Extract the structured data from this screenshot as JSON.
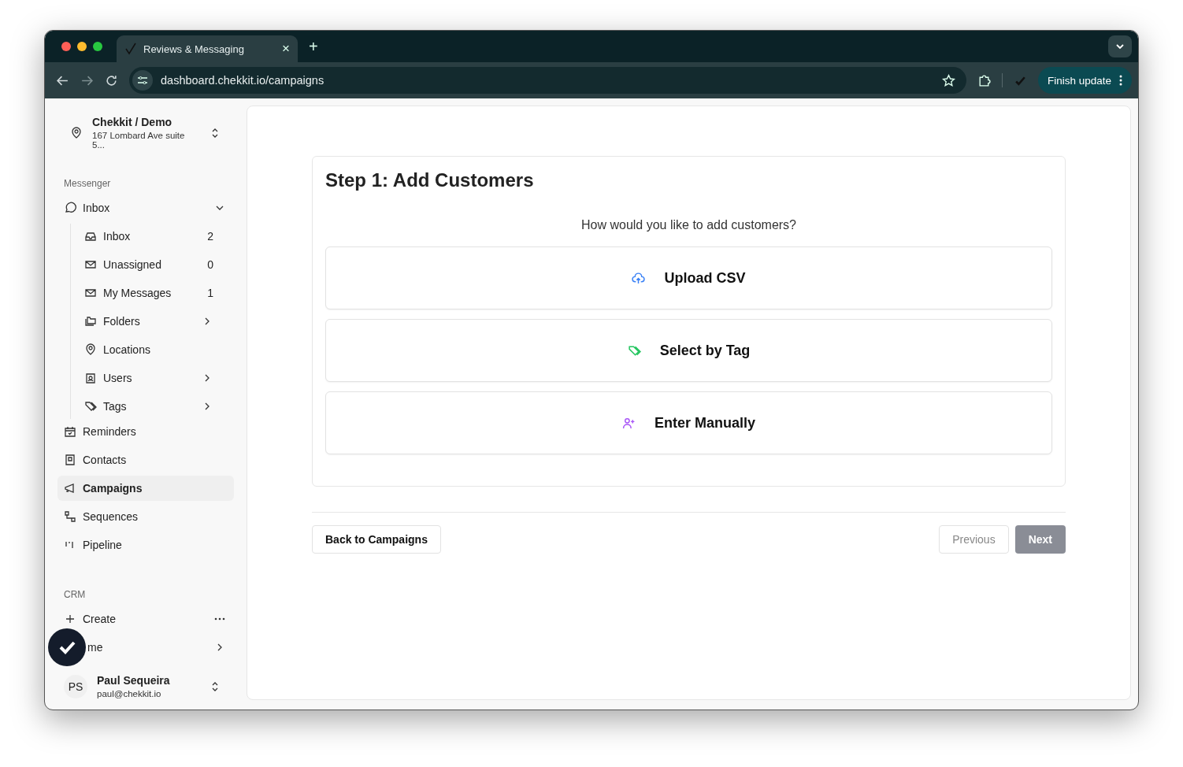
{
  "browser": {
    "tab": {
      "title": "Reviews & Messaging",
      "close": "×"
    },
    "new_tab": "+",
    "address": "dashboard.chekkit.io/campaigns",
    "update_button": "Finish update"
  },
  "sidebar": {
    "org": {
      "name": "Chekkit / Demo",
      "address": "167 Lombard Ave suite 5..."
    },
    "sections": [
      {
        "title": "Messenger",
        "items": [
          {
            "label": "Inbox",
            "expanded": true,
            "selected": false,
            "children": [
              {
                "label": "Inbox",
                "count": "2",
                "expandable": false
              },
              {
                "label": "Unassigned",
                "count": "0",
                "expandable": false
              },
              {
                "label": "My Messages",
                "count": "1",
                "expandable": false
              },
              {
                "label": "Folders",
                "expandable": true
              },
              {
                "label": "Locations",
                "expandable": false
              },
              {
                "label": "Users",
                "expandable": true
              },
              {
                "label": "Tags",
                "expandable": true
              }
            ]
          },
          {
            "label": "Reminders",
            "selected": false
          },
          {
            "label": "Contacts",
            "selected": false
          },
          {
            "label": "Campaigns",
            "selected": true
          },
          {
            "label": "Sequences",
            "selected": false
          },
          {
            "label": "Pipeline",
            "selected": false
          }
        ]
      },
      {
        "title": "CRM",
        "items": [
          {
            "label": "Create",
            "selected": false,
            "kind": "more"
          },
          {
            "label": "me",
            "selected": false,
            "kind": "chevron"
          }
        ]
      }
    ],
    "user": {
      "initials": "PS",
      "name": "Paul Sequeira",
      "email": "paul@chekkit.io"
    }
  },
  "wizard": {
    "title": "Step 1: Add Customers",
    "question": "How would you like to add customers?",
    "options": [
      {
        "label": "Upload CSV",
        "color": "#3b82f6"
      },
      {
        "label": "Select by Tag",
        "color": "#22c55e"
      },
      {
        "label": "Enter Manually",
        "color": "#a855f7"
      }
    ],
    "back_button": "Back to Campaigns",
    "previous_button": {
      "label": "Previous",
      "disabled": true
    },
    "next_button": {
      "label": "Next",
      "disabled": true
    }
  }
}
